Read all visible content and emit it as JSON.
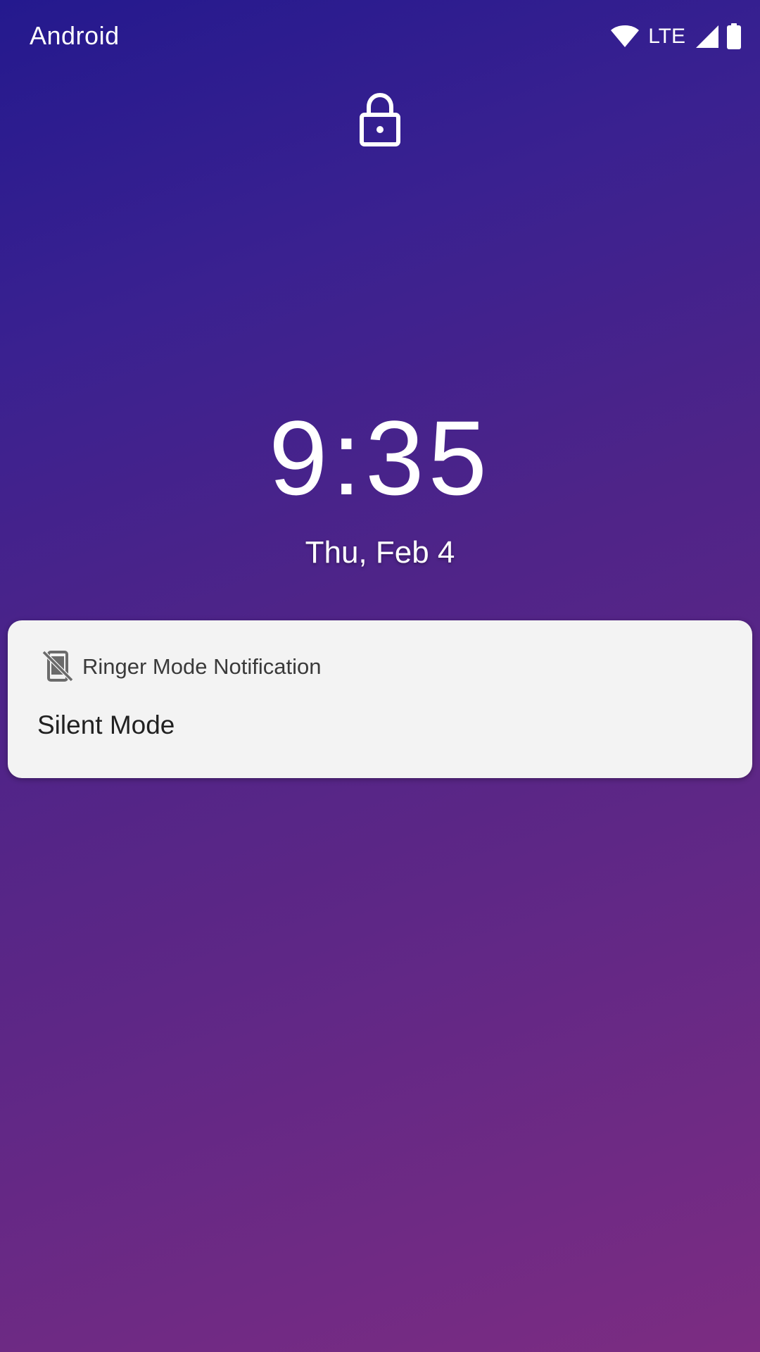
{
  "status_bar": {
    "carrier": "Android",
    "network_label": "LTE",
    "icons": [
      "wifi-icon",
      "cell-signal-icon",
      "battery-icon"
    ]
  },
  "lockscreen": {
    "lock_icon": "lock-icon",
    "time": "9:35",
    "date": "Thu, Feb 4"
  },
  "notification": {
    "icon": "phone-silent-icon",
    "app_name": "Ringer Mode Notification",
    "text": "Silent Mode"
  },
  "colors": {
    "background_start": "#24198e",
    "background_end": "#7c2c82",
    "card_background": "#f3f3f3"
  }
}
